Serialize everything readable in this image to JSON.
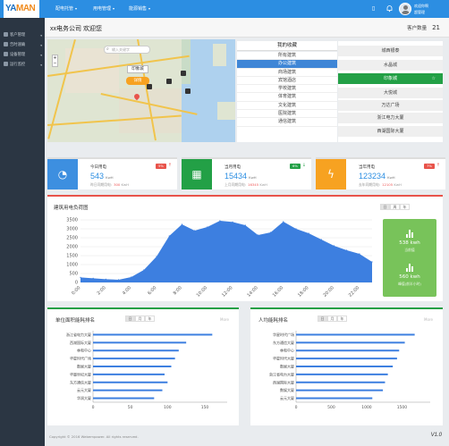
{
  "logo": {
    "part1": "YA",
    "part2": "MAN"
  },
  "topnav": [
    {
      "label": "配电托管"
    },
    {
      "label": "用电管理"
    },
    {
      "label": "能源销售"
    }
  ],
  "user": {
    "line1": "欢迎你啊",
    "line2": "超管理"
  },
  "sidebar": [
    {
      "label": "客户管理"
    },
    {
      "label": "告时速确"
    },
    {
      "label": "设备管理"
    },
    {
      "label": "运行监控"
    }
  ],
  "header": {
    "company": "xx电务公司  欢迎您",
    "count_label": "客户数量",
    "count": "21"
  },
  "map": {
    "search_placeholder": "输入关键字",
    "plus": "+",
    "minus": "−",
    "city": "印象城",
    "button": "详情"
  },
  "favorites": {
    "title": "我的收藏",
    "items": [
      "所有建筑",
      "办公建筑",
      "商场建筑",
      "宾馆酒店",
      "学校建筑",
      "体育建筑",
      "文化建筑",
      "医院建筑",
      "通信建筑"
    ],
    "selected_index": 1
  },
  "buildings": {
    "items": [
      "城西银泰",
      "水晶城",
      "印象城",
      "大悦城",
      "万达广场",
      "浙江电力大厦",
      "西湖国际大厦"
    ],
    "selected_index": 2,
    "star": "☆"
  },
  "cards": [
    {
      "title": "今日用电",
      "value": "543",
      "unit": "KwH",
      "sub_label": "昨日同期用电:",
      "sub_value": "300",
      "sub_unit": "KwH",
      "badge": "5%",
      "arrow": "↑",
      "color": "#3d8fe0",
      "badge_color": "#e8534a",
      "arrow_color": "#e8534a",
      "icon": "gauge-icon"
    },
    {
      "title": "当月用电",
      "value": "15434",
      "unit": "KwH",
      "sub_label": "上月同期用电:",
      "sub_value": "16345",
      "sub_unit": "KwH",
      "badge": "6%",
      "arrow": "↓",
      "color": "#23a046",
      "badge_color": "#23a046",
      "arrow_color": "#23a046",
      "icon": "calendar-icon"
    },
    {
      "title": "当年用电",
      "value": "123234",
      "unit": "KwH",
      "sub_label": "去年同期用电:",
      "sub_value": "12105",
      "sub_unit": "KwH",
      "badge": "7%",
      "arrow": "↑",
      "color": "#f7a221",
      "badge_color": "#e8534a",
      "arrow_color": "#e8534a",
      "icon": "bolt-icon"
    }
  ],
  "load_chart": {
    "title": "建筑用电负荷图",
    "tabs": [
      "日",
      "周",
      "年"
    ],
    "green": {
      "v1": "538 kwh",
      "l1": "当前值",
      "v2": "560 kwh",
      "l2": "峰值(前半小时)"
    }
  },
  "rank1": {
    "title": "单位面积能耗排名",
    "tabs": [
      "日",
      "月",
      "年"
    ],
    "more": "More"
  },
  "rank2": {
    "title": "人均能耗排名",
    "tabs": [
      "日",
      "月",
      "年"
    ],
    "more": "More"
  },
  "footer": {
    "copyright": "Copyright © 2016 Webempower. All rights reserved.",
    "version": "V1.0"
  },
  "chart_data": [
    {
      "type": "area",
      "title": "建筑用电负荷图",
      "x": [
        "0:00",
        "1:00",
        "2:00",
        "3:00",
        "4:00",
        "5:00",
        "6:00",
        "7:00",
        "8:00",
        "9:00",
        "10:00",
        "11:00",
        "12:00",
        "13:00",
        "14:00",
        "15:00",
        "16:00",
        "17:00",
        "18:00",
        "19:00",
        "20:00",
        "21:00",
        "22:00",
        "23:00"
      ],
      "y": [
        280,
        230,
        180,
        150,
        300,
        700,
        1450,
        2600,
        3250,
        2900,
        3100,
        3450,
        3380,
        3200,
        2650,
        2800,
        3400,
        3000,
        2750,
        2400,
        2050,
        1800,
        1600,
        1150
      ],
      "ylim": [
        0,
        3500
      ],
      "yticks": [
        0,
        500,
        1000,
        1500,
        2000,
        2500,
        3000,
        3500
      ],
      "xticks": [
        "0:00",
        "2:00",
        "4:00",
        "6:00",
        "8:00",
        "10:00",
        "12:00",
        "14:00",
        "16:00",
        "18:00",
        "20:00",
        "22:00"
      ],
      "grid": true,
      "color": "#3d7fe0"
    },
    {
      "type": "bar",
      "orientation": "horizontal",
      "title": "单位面积能耗排名",
      "categories": [
        "浙江省电力大厦",
        "西湖国际大厦",
        "林和中心",
        "华星时代广场",
        "数娱大厦",
        "华量世纪大厦",
        "东方通信大厦",
        "云元大厦",
        "华润大厦"
      ],
      "values": [
        160,
        125,
        115,
        110,
        105,
        96,
        100,
        93,
        82
      ],
      "xlim": [
        0,
        180
      ],
      "xticks": [
        0,
        50,
        100,
        150
      ],
      "color": "#3d7fe0"
    },
    {
      "type": "bar",
      "orientation": "horizontal",
      "title": "人均能耗排名",
      "categories": [
        "华星时代广场",
        "东方通信大厦",
        "林和中心",
        "华星时代大厦",
        "数娱大厦",
        "浙江省电力大厦",
        "西湖国际大厦",
        "数娱大厦",
        "云元大厦"
      ],
      "values": [
        1680,
        1540,
        1460,
        1430,
        1370,
        1300,
        1260,
        1230,
        1080
      ],
      "xlim": [
        0,
        1900
      ],
      "xticks": [
        0,
        500,
        1000,
        1500
      ],
      "color": "#3d7fe0"
    }
  ]
}
